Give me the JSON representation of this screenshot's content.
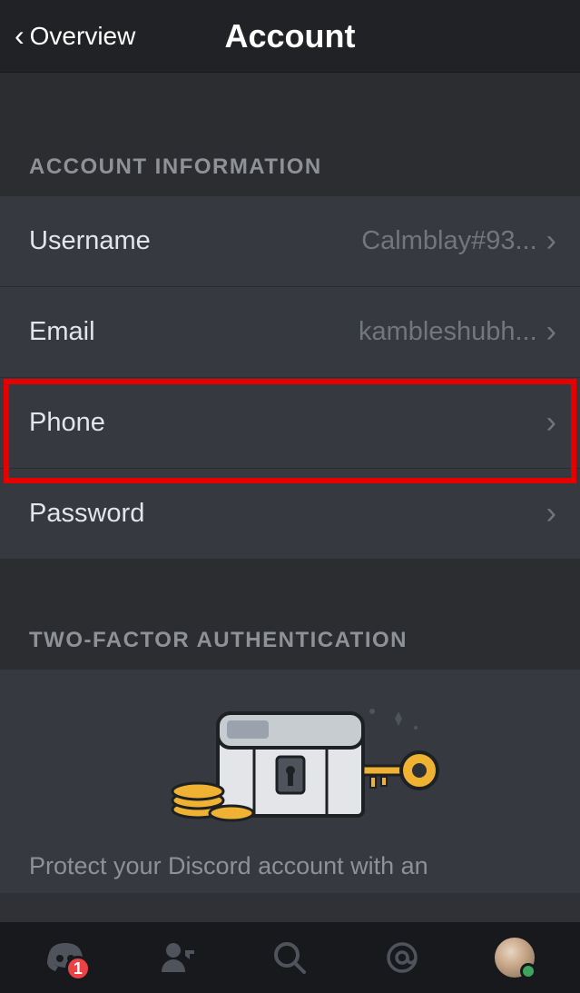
{
  "header": {
    "back_label": "Overview",
    "title": "Account"
  },
  "sections": {
    "accountInfo": {
      "header": "ACCOUNT INFORMATION",
      "rows": {
        "username": {
          "label": "Username",
          "value": "Calmblay#93..."
        },
        "email": {
          "label": "Email",
          "value": "kambleshubh..."
        },
        "phone": {
          "label": "Phone",
          "value": ""
        },
        "password": {
          "label": "Password",
          "value": ""
        }
      }
    },
    "twofa": {
      "header": "TWO-FACTOR AUTHENTICATION",
      "description": "Protect your Discord account with an"
    }
  },
  "tabbar": {
    "badge_count": "1"
  }
}
